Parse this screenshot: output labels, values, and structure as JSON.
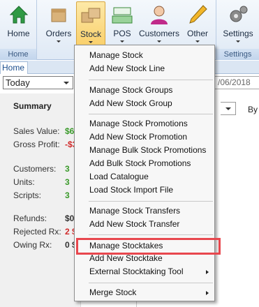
{
  "ribbon": {
    "groups": [
      {
        "title": "Home"
      },
      {
        "title": ""
      },
      {
        "title": "Settings"
      }
    ],
    "buttons": {
      "home": "Home",
      "orders": "Orders",
      "stock": "Stock",
      "pos": "POS",
      "customers": "Customers",
      "other": "Other",
      "settings": "Settings"
    }
  },
  "tabs": {
    "home": "Home"
  },
  "filter": {
    "period": "Today",
    "date_partial": "/06/2018",
    "by_label": "By"
  },
  "summary": {
    "title": "Summary",
    "rows": [
      {
        "label": "Sales Value:",
        "value": "$6",
        "color": "#3a9a2a"
      },
      {
        "label": "Gross Profit:",
        "value": "-$3",
        "color": "#d02a2a"
      },
      {
        "label": "Customers:",
        "value": "3",
        "color": "#3a9a2a"
      },
      {
        "label": "Units:",
        "value": "3",
        "color": "#3a9a2a"
      },
      {
        "label": "Scripts:",
        "value": "3",
        "color": "#3a9a2a"
      },
      {
        "label": "Refunds:",
        "value": "$0",
        "color": "#333333"
      },
      {
        "label": "Rejected Rx:",
        "value": "2 $",
        "color": "#d02a2a"
      },
      {
        "label": "Owing Rx:",
        "value": "0 $",
        "color": "#333333"
      }
    ]
  },
  "stock_menu": {
    "items": [
      "Manage Stock",
      "Add New Stock Line",
      "Manage Stock Groups",
      "Add New Stock Group",
      "Manage Stock Promotions",
      "Add New Stock Promotion",
      "Manage Bulk Stock Promotions",
      "Add Bulk Stock Promotions",
      "Load Catalogue",
      "Load Stock Import File",
      "Manage Stock Transfers",
      "Add New Stock Transfer",
      "Manage Stocktakes",
      "Add New Stocktake",
      "External Stocktaking Tool",
      "Merge Stock"
    ],
    "highlighted": "Manage Stocktakes"
  },
  "colors": {
    "highlight_border": "#e8474e",
    "active_button": "#f9cf6a"
  }
}
